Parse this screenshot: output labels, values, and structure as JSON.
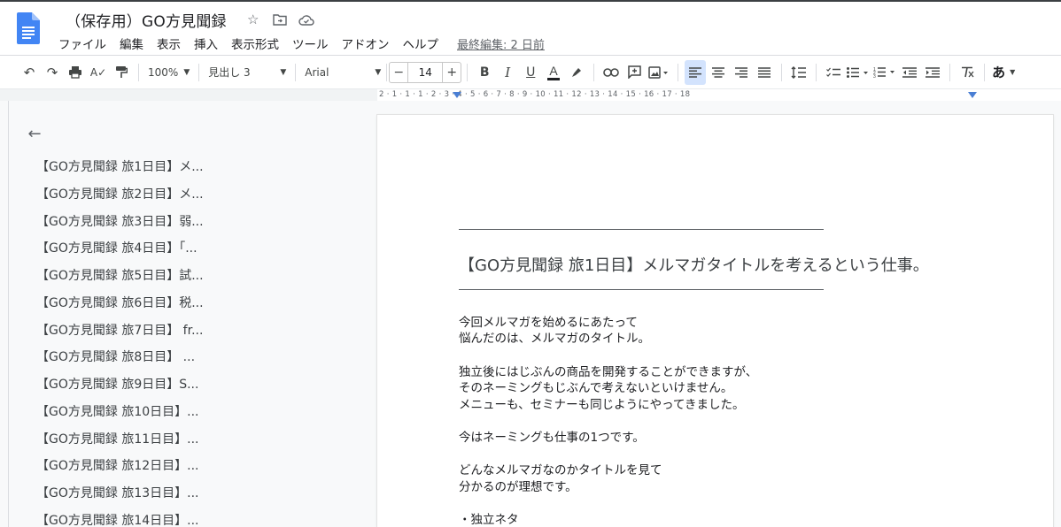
{
  "header": {
    "title": "（保存用）GO方見聞録",
    "menu": [
      "ファイル",
      "編集",
      "表示",
      "挿入",
      "表示形式",
      "ツール",
      "アドオン",
      "ヘルプ"
    ],
    "last_edit": "最終編集: 2 日前"
  },
  "toolbar": {
    "zoom": "100%",
    "style": "見出し 3",
    "font": "Arial",
    "font_size": "14",
    "minus": "−",
    "plus": "+",
    "input_tool": "あ"
  },
  "ruler": {
    "labels": "2 · 1 · 1 · 1 · 2 · 3 · 4 · 5 · 6 · 7 · 8 · 9 · 10 · 11 · 12 · 13 · 14 · 15 · 16 · 17 · 18"
  },
  "outline": {
    "items": [
      "【GO方見聞録 旅1日目】メ...",
      "【GO方見聞録 旅2日目】メ...",
      "【GO方見聞録 旅3日目】弱...",
      "【GO方見聞録 旅4日目】「...",
      "【GO方見聞録 旅5日目】試...",
      "【GO方見聞録 旅6日目】税...",
      "【GO方見聞録 旅7日目】 fr...",
      "【GO方見聞録 旅8日目】 ...",
      "【GO方見聞録 旅9日目】S...",
      "【GO方見聞録 旅10日目】...",
      "【GO方見聞録 旅11日目】...",
      "【GO方見聞録 旅12日目】...",
      "【GO方見聞録 旅13日目】...",
      "【GO方見聞録 旅14日目】..."
    ]
  },
  "document": {
    "heading": "【GO方見聞録 旅1日目】メルマガタイトルを考えるという仕事。",
    "paragraphs": [
      [
        "今回メルマガを始めるにあたって",
        "悩んだのは、メルマガのタイトル。"
      ],
      [
        "独立後にはじぶんの商品を開発することができますが、",
        "そのネーミングもじぶんで考えないといけません。",
        "メニューも、セミナーも同じようにやってきました。"
      ],
      [
        "今はネーミングも仕事の1つです。"
      ],
      [
        "どんなメルマガなのかタイトルを見て",
        "分かるのが理想です。"
      ],
      [
        "・独立ネタ"
      ]
    ]
  }
}
